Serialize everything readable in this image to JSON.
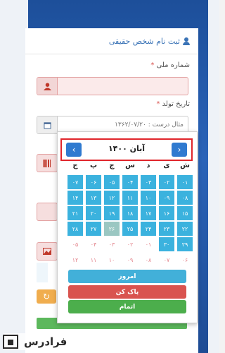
{
  "form": {
    "title": "ثبت نام شخص حقیقی",
    "national_code_label": "شماره ملی",
    "birth_date_label": "تاریخ تولد",
    "required_mark": "*",
    "birth_date_placeholder": "مثال درست : ۱۳۶۲/۰۷/۲۰"
  },
  "calendar": {
    "month_title": "آبان ۱۴۰۰",
    "prev_label": "‹",
    "next_label": "›",
    "weekdays": [
      "ش",
      "ی",
      "د",
      "س",
      "چ",
      "پ",
      "ج"
    ],
    "rows": [
      [
        [
          "۰۱",
          "on"
        ],
        [
          "۰۲",
          "on"
        ],
        [
          "۰۳",
          "on"
        ],
        [
          "۰۴",
          "on"
        ],
        [
          "۰۵",
          "on"
        ],
        [
          "۰۶",
          "on"
        ],
        [
          "۰۷",
          "on"
        ]
      ],
      [
        [
          "۰۸",
          "on"
        ],
        [
          "۰۹",
          "on"
        ],
        [
          "۱۰",
          "on"
        ],
        [
          "۱۱",
          "on"
        ],
        [
          "۱۲",
          "on"
        ],
        [
          "۱۳",
          "on"
        ],
        [
          "۱۴",
          "on"
        ]
      ],
      [
        [
          "۱۵",
          "on"
        ],
        [
          "۱۶",
          "on"
        ],
        [
          "۱۷",
          "on"
        ],
        [
          "۱۸",
          "on"
        ],
        [
          "۱۹",
          "on"
        ],
        [
          "۲۰",
          "on"
        ],
        [
          "۲۱",
          "on"
        ]
      ],
      [
        [
          "۲۲",
          "on"
        ],
        [
          "۲۳",
          "on"
        ],
        [
          "۲۴",
          "on"
        ],
        [
          "۲۵",
          "on"
        ],
        [
          "۲۶",
          "today"
        ],
        [
          "۲۷",
          "on"
        ],
        [
          "۲۸",
          "on"
        ]
      ],
      [
        [
          "۲۹",
          "on"
        ],
        [
          "۳۰",
          "on"
        ],
        [
          "۰۱",
          "off"
        ],
        [
          "۰۲",
          "off"
        ],
        [
          "۰۳",
          "off"
        ],
        [
          "۰۴",
          "off"
        ],
        [
          "۰۵",
          "off"
        ]
      ],
      [
        [
          "۰۶",
          "off"
        ],
        [
          "۰۷",
          "off"
        ],
        [
          "۰۸",
          "off"
        ],
        [
          "۰۹",
          "off"
        ],
        [
          "۱۰",
          "off"
        ],
        [
          "۱۱",
          "off"
        ],
        [
          "۱۲",
          "off"
        ]
      ]
    ],
    "today_button": "امروز",
    "clear_button": "پاک کن",
    "done_button": "اتمام"
  },
  "watermark": {
    "text": "فرادرس"
  }
}
